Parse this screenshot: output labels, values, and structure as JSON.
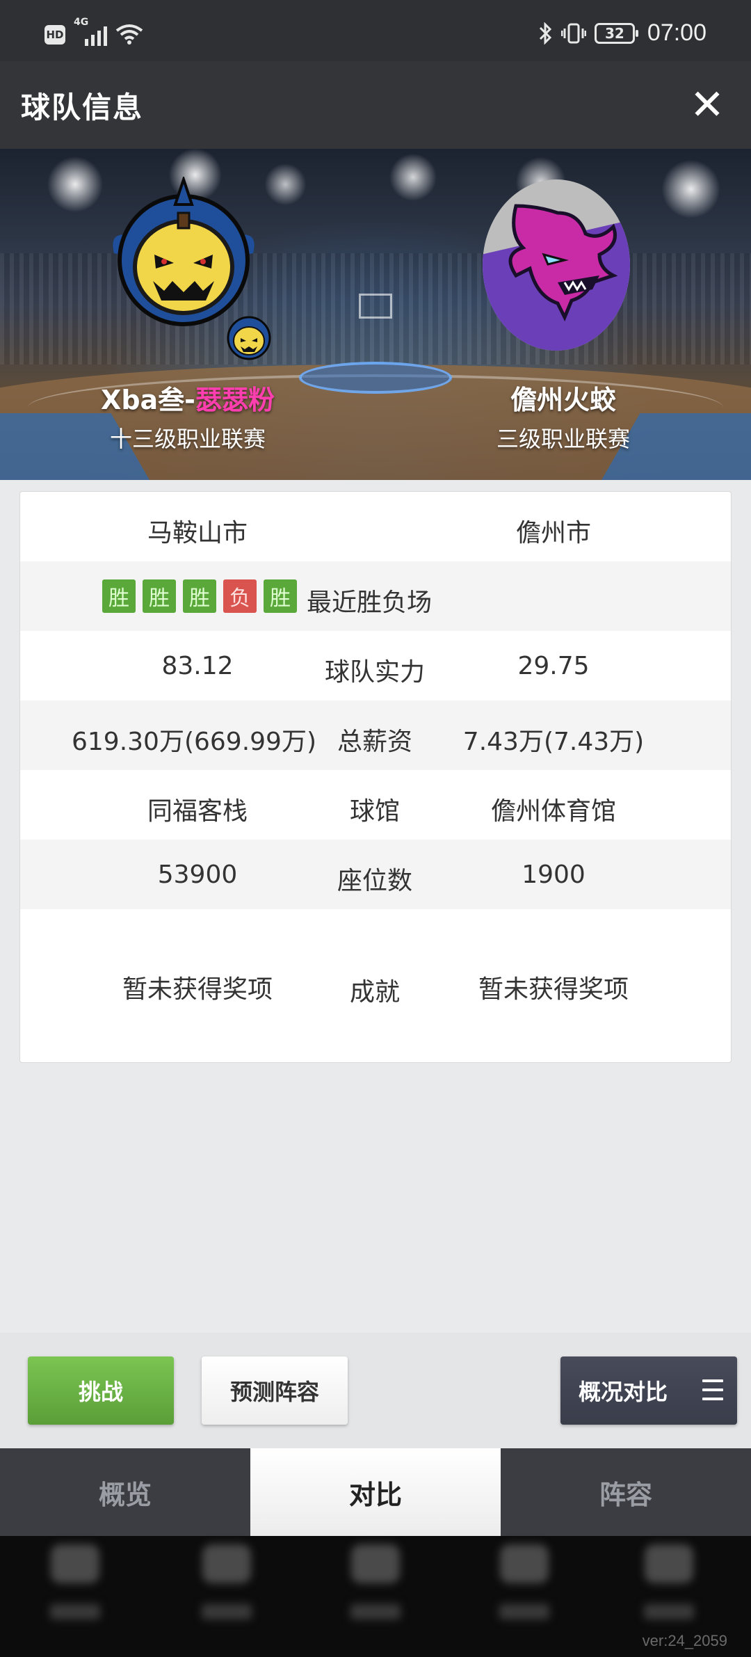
{
  "status_bar": {
    "hd": "HD",
    "network": "4G",
    "battery": "32",
    "time": "07:00"
  },
  "header": {
    "title": "球队信息",
    "close": "✕"
  },
  "teams": {
    "left": {
      "name_prefix": "Xba叁-",
      "name_highlight": "瑟瑟粉",
      "league": "十三级职业联赛"
    },
    "right": {
      "name": "儋州火蛟",
      "league": "三级职业联赛"
    }
  },
  "comparison": {
    "city": {
      "left": "马鞍山市",
      "right": "儋州市"
    },
    "recent": {
      "label": "最近胜负场",
      "results": [
        "胜",
        "胜",
        "胜",
        "负",
        "胜"
      ]
    },
    "strength": {
      "label": "球队实力",
      "left": "83.12",
      "right": "29.75"
    },
    "salary": {
      "label": "总薪资",
      "left": "619.30万(669.99万)",
      "right": "7.43万(7.43万)"
    },
    "arena": {
      "label": "球馆",
      "left": "同福客栈",
      "right": "儋州体育馆"
    },
    "seats": {
      "label": "座位数",
      "left": "53900",
      "right": "1900"
    },
    "achievements": {
      "label": "成就",
      "left": "暂未获得奖项",
      "right": "暂未获得奖项"
    }
  },
  "actions": {
    "challenge": "挑战",
    "predict": "预测阵容",
    "compare": "概况对比"
  },
  "tabs": [
    "概览",
    "对比",
    "阵容"
  ],
  "active_tab": "对比",
  "version": "ver:24_2059",
  "colors": {
    "win": "#5aa73a",
    "loss": "#d9534f",
    "highlight_pink": "#ff3fb0",
    "challenge_green": "#6bb545"
  }
}
